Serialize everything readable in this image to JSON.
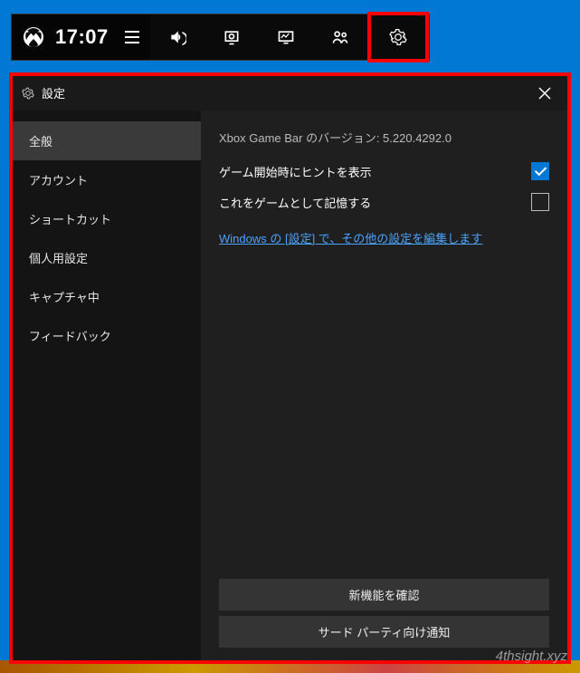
{
  "topbar": {
    "time": "17:07"
  },
  "window": {
    "title": "設定"
  },
  "sidebar": {
    "items": [
      {
        "label": "全般",
        "active": true
      },
      {
        "label": "アカウント",
        "active": false
      },
      {
        "label": "ショートカット",
        "active": false
      },
      {
        "label": "個人用設定",
        "active": false
      },
      {
        "label": "キャプチャ中",
        "active": false
      },
      {
        "label": "フィードバック",
        "active": false
      }
    ]
  },
  "main": {
    "version_text": "Xbox Game Bar のバージョン: 5.220.4292.0",
    "option1_label": "ゲーム開始時にヒントを表示",
    "option1_checked": true,
    "option2_label": "これをゲームとして記憶する",
    "option2_checked": false,
    "link_text": "Windows の [設定] で、その他の設定を編集します",
    "button_whats_new": "新機能を確認",
    "button_third_party": "サード パーティ向け通知"
  },
  "watermark": "4thsight.xyz"
}
